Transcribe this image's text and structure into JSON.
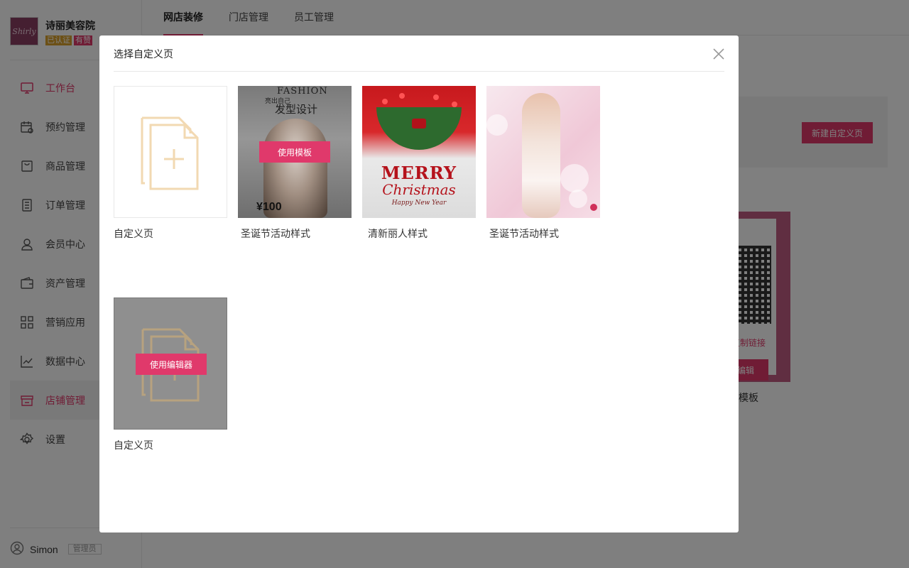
{
  "sidebar": {
    "shop": {
      "logo_text": "Shirly",
      "name": "诗丽美容院",
      "badge_auth": "已认证",
      "badge_zan": "有赞"
    },
    "items": [
      {
        "label": "工作台",
        "icon": "monitor-icon"
      },
      {
        "label": "预约管理",
        "icon": "calendar-icon"
      },
      {
        "label": "商品管理",
        "icon": "bag-icon"
      },
      {
        "label": "订单管理",
        "icon": "order-list-icon"
      },
      {
        "label": "会员中心",
        "icon": "user-icon"
      },
      {
        "label": "资产管理",
        "icon": "wallet-icon"
      },
      {
        "label": "营销应用",
        "icon": "apps-grid-icon"
      },
      {
        "label": "数据中心",
        "icon": "chart-line-icon"
      },
      {
        "label": "店铺管理",
        "icon": "store-icon"
      },
      {
        "label": "设置",
        "icon": "gear-icon"
      }
    ],
    "user": {
      "name": "Simon",
      "role": "管理员"
    }
  },
  "topbar": {
    "tabs": [
      {
        "label": "网店装修"
      },
      {
        "label": "门店管理"
      },
      {
        "label": "员工管理"
      }
    ]
  },
  "background": {
    "new_page_label": "新建自定义页",
    "copy_link_label": "复制链接",
    "edit_label": "编辑",
    "card_label": "模板"
  },
  "modal": {
    "title": "选择自定义页",
    "use_template_label": "使用模板",
    "use_editor_label": "使用编辑器",
    "templates": [
      {
        "label": "自定义页"
      },
      {
        "label": "圣诞节活动样式",
        "image_text": {
          "line1": "FASHION",
          "line2": "亮出自己",
          "line3": "发型设计",
          "price": "¥100"
        }
      },
      {
        "label": "清新丽人样式",
        "image_text": {
          "line1": "MERRY",
          "line2": "Christmas",
          "line3": "Happy New Year"
        }
      },
      {
        "label": "圣诞节活动样式"
      },
      {
        "label": "自定义页"
      }
    ]
  },
  "colors": {
    "accent": "#e0396b",
    "badge_auth": "#d9a12c",
    "blank_icon": "#f2d9b2"
  }
}
